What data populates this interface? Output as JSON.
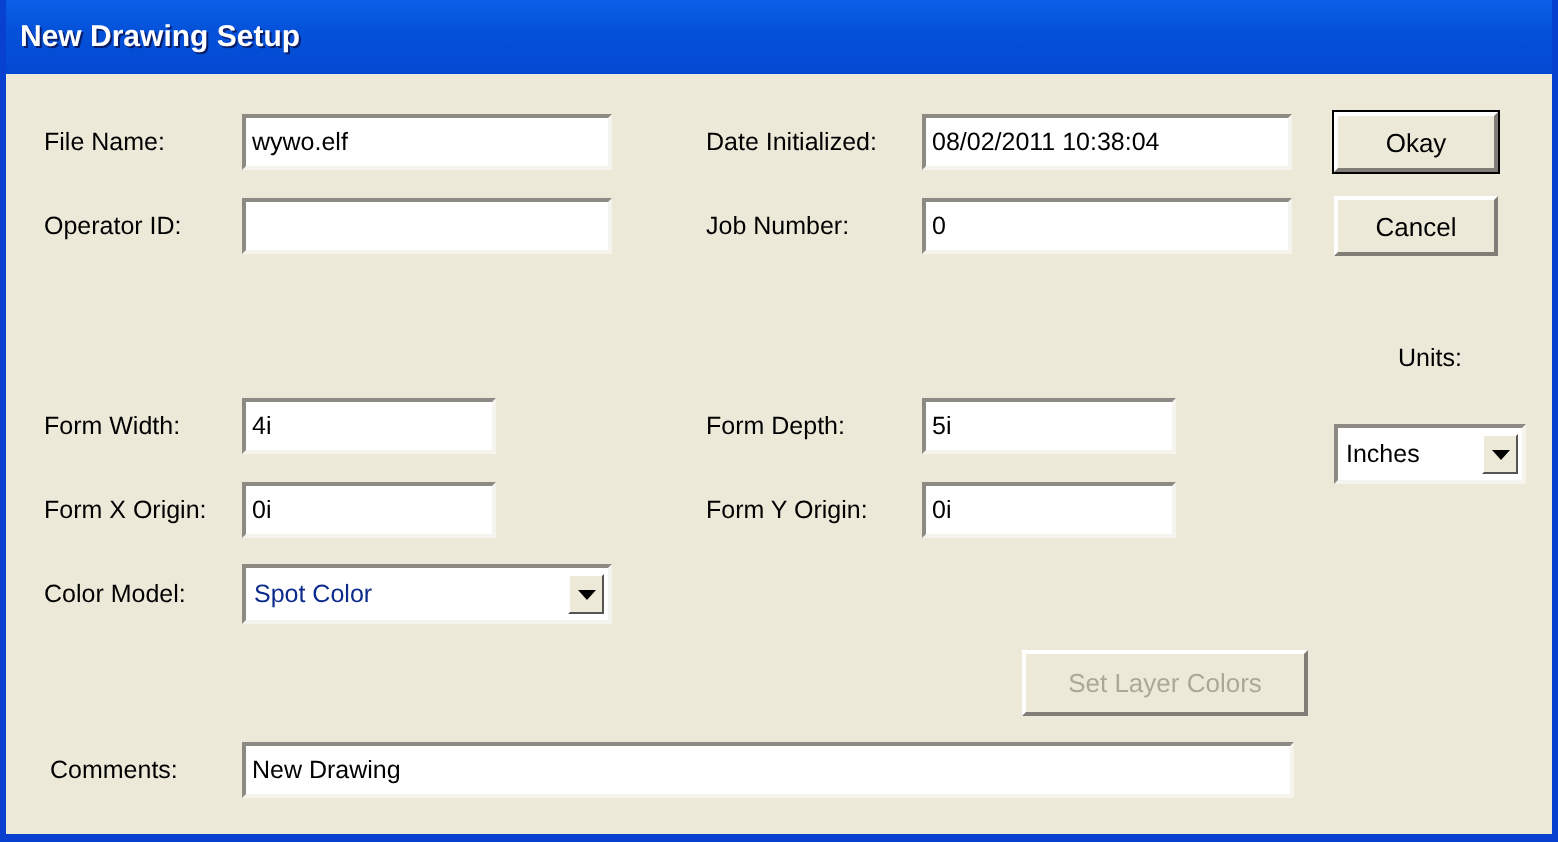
{
  "window": {
    "title": "New Drawing Setup"
  },
  "fields": [
    {
      "label": "File Name:",
      "value": "wywo.elf"
    },
    {
      "label": "Date Initialized:",
      "value": "08/02/2011 10:38:04"
    },
    {
      "label": "Operator ID:"
    },
    {
      "label": "Job Number:",
      "value": "0"
    },
    {
      "label": "Form Width:",
      "value": "4i"
    },
    {
      "label": "Form Depth:",
      "value": "5i"
    },
    {
      "label": "Form X Origin:",
      "value": "0i"
    },
    {
      "label": "Form Y Origin:",
      "value": "0i"
    }
  ],
  "color_model": {
    "label": "Color Model:",
    "value": "Spot Color"
  },
  "units": {
    "label": "Units:",
    "value": "Inches"
  },
  "comments": {
    "label": "Comments:",
    "value": "New Drawing"
  },
  "buttons": [
    {
      "label": "Okay",
      "default": true,
      "disabled": false
    },
    {
      "label": "Cancel",
      "default": false,
      "disabled": false
    },
    {
      "label": "Set Layer Colors",
      "default": false,
      "disabled": true
    }
  ]
}
